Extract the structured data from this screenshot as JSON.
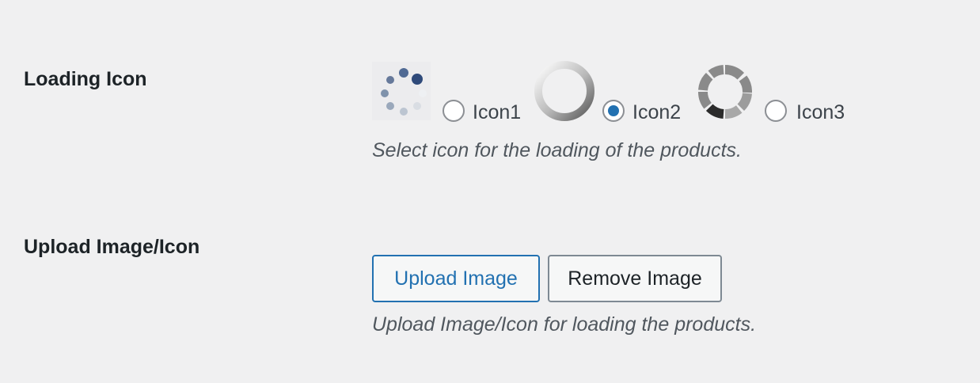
{
  "loading_icon": {
    "label": "Loading Icon",
    "options": [
      {
        "label": "Icon1",
        "checked": false,
        "icon": "dots-spinner-icon"
      },
      {
        "label": "Icon2",
        "checked": true,
        "icon": "ring-spinner-icon"
      },
      {
        "label": "Icon3",
        "checked": false,
        "icon": "segmented-ring-spinner-icon"
      }
    ],
    "description": "Select icon for the loading of the products."
  },
  "upload_image": {
    "label": "Upload Image/Icon",
    "upload_button": "Upload Image",
    "remove_button": "Remove Image",
    "description": "Upload Image/Icon for loading the products."
  },
  "colors": {
    "background": "#f0f0f1",
    "accent": "#2271b1"
  }
}
